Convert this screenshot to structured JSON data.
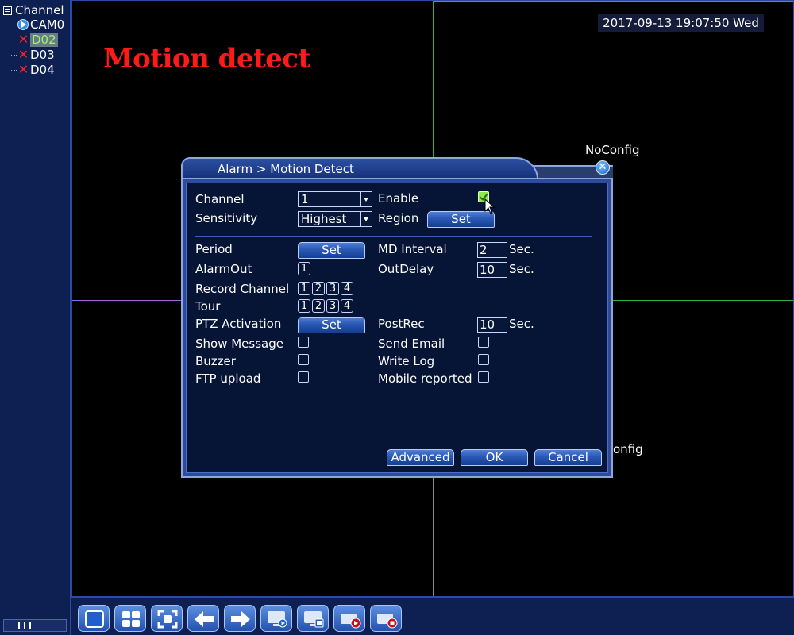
{
  "channel_tree": {
    "root_label": "Channel",
    "items": [
      {
        "label": "CAM0",
        "status": "online"
      },
      {
        "label": "D02",
        "status": "offline",
        "selected": true
      },
      {
        "label": "D03",
        "status": "offline"
      },
      {
        "label": "D04",
        "status": "offline"
      }
    ]
  },
  "video": {
    "osd_title": "Motion detect",
    "datetime": "2017-09-13 19:07:50 Wed",
    "noconfig_1": "NoConfig",
    "noconfig_2": "onfig"
  },
  "dialog": {
    "title": "Alarm > Motion Detect",
    "channel_label": "Channel",
    "channel_value": "1",
    "enable_label": "Enable",
    "enable_checked": true,
    "sensitivity_label": "Sensitivity",
    "sensitivity_value": "Highest",
    "region_label": "Region",
    "set_label": "Set",
    "period_label": "Period",
    "md_interval_label": "MD Interval",
    "md_interval_value": "2",
    "sec_label": "Sec.",
    "alarmout_label": "AlarmOut",
    "outdelay_label": "OutDelay",
    "outdelay_value": "10",
    "record_channel_label": "Record Channel",
    "tour_label": "Tour",
    "ptz_label": "PTZ Activation",
    "postrec_label": "PostRec",
    "postrec_value": "10",
    "show_message_label": "Show Message",
    "send_email_label": "Send Email",
    "buzzer_label": "Buzzer",
    "write_log_label": "Write Log",
    "ftp_upload_label": "FTP upload",
    "mobile_reported_label": "Mobile reported",
    "channel_numbers": [
      "1",
      "2",
      "3",
      "4"
    ],
    "alarmout_numbers": [
      "1"
    ],
    "advanced_label": "Advanced",
    "ok_label": "OK",
    "cancel_label": "Cancel"
  },
  "toolbar": {
    "icons": [
      "single-view-icon",
      "quad-view-icon",
      "fullscreen-icon",
      "previous-icon",
      "next-icon",
      "monitor-play-icon",
      "monitor-grid-icon",
      "record-icon",
      "stop-record-icon"
    ]
  },
  "colors": {
    "panel_bg": "#0e1f52",
    "dialog_bg": "#061536",
    "accent_red": "#ff1a1a",
    "grid_green": "#2bb24c",
    "grid_purple": "#a06bd8"
  }
}
